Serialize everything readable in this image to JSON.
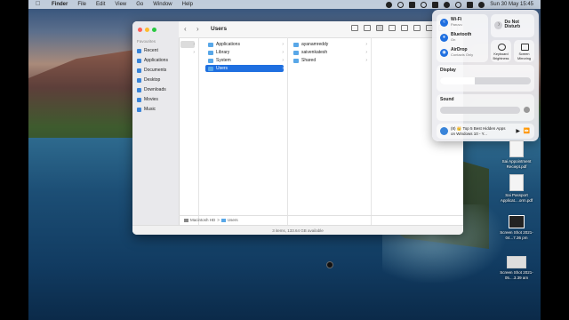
{
  "menubar": {
    "app": "Finder",
    "items": [
      "File",
      "Edit",
      "View",
      "Go",
      "Window",
      "Help"
    ],
    "clock": "Sun 30 May  15:45"
  },
  "finder": {
    "title": "Users",
    "sidebar_heading": "Favourites",
    "sidebar": [
      {
        "label": "Recent",
        "icon": "clock-icon"
      },
      {
        "label": "Applications",
        "icon": "applications-icon"
      },
      {
        "label": "Documents",
        "icon": "document-icon"
      },
      {
        "label": "Desktop",
        "icon": "desktop-icon"
      },
      {
        "label": "Downloads",
        "icon": "download-icon"
      },
      {
        "label": "Movies",
        "icon": "movie-icon"
      },
      {
        "label": "Music",
        "icon": "music-icon"
      }
    ],
    "column1": [
      "Applications",
      "Library",
      "System",
      "Users"
    ],
    "column2": [
      "ayanamreddy",
      "saivenkatesh",
      "Shared"
    ],
    "path": [
      "Macintosh HD",
      "Users"
    ],
    "path_sep": ">",
    "status": "3 items, 133.64 GB available"
  },
  "control_center": {
    "wifi": {
      "label": "Wi-Fi",
      "sub": "Paruvu"
    },
    "bluetooth": {
      "label": "Bluetooth",
      "sub": "On"
    },
    "airdrop": {
      "label": "AirDrop",
      "sub": "Contacts Only"
    },
    "dnd": {
      "label": "Do Not Disturb"
    },
    "keyboard": {
      "label": "Keyboard Brightness"
    },
    "mirroring": {
      "label": "Screen Mirroring"
    },
    "display": {
      "label": "Display",
      "level": 0.38
    },
    "sound": {
      "label": "Sound",
      "level": 0.0
    },
    "music": {
      "title": "(8) 👑 Top 5 Best Hidden Apps on Windows 10 - Y..."
    }
  },
  "desktop": [
    {
      "label": "Sai Appointment Reciept.pdf"
    },
    {
      "label": "Sai Passport Applicat....orm.pdf"
    },
    {
      "label": "Screen Shot 2021-04...7.36 pm"
    },
    {
      "label": "Screen Shot 2021-05....3.39 am"
    }
  ],
  "colors": {
    "accent": "#1f6fe0",
    "folder": "#58a7e8",
    "close": "#ff5f57",
    "minimize": "#febc2e",
    "zoom": "#28c840"
  }
}
